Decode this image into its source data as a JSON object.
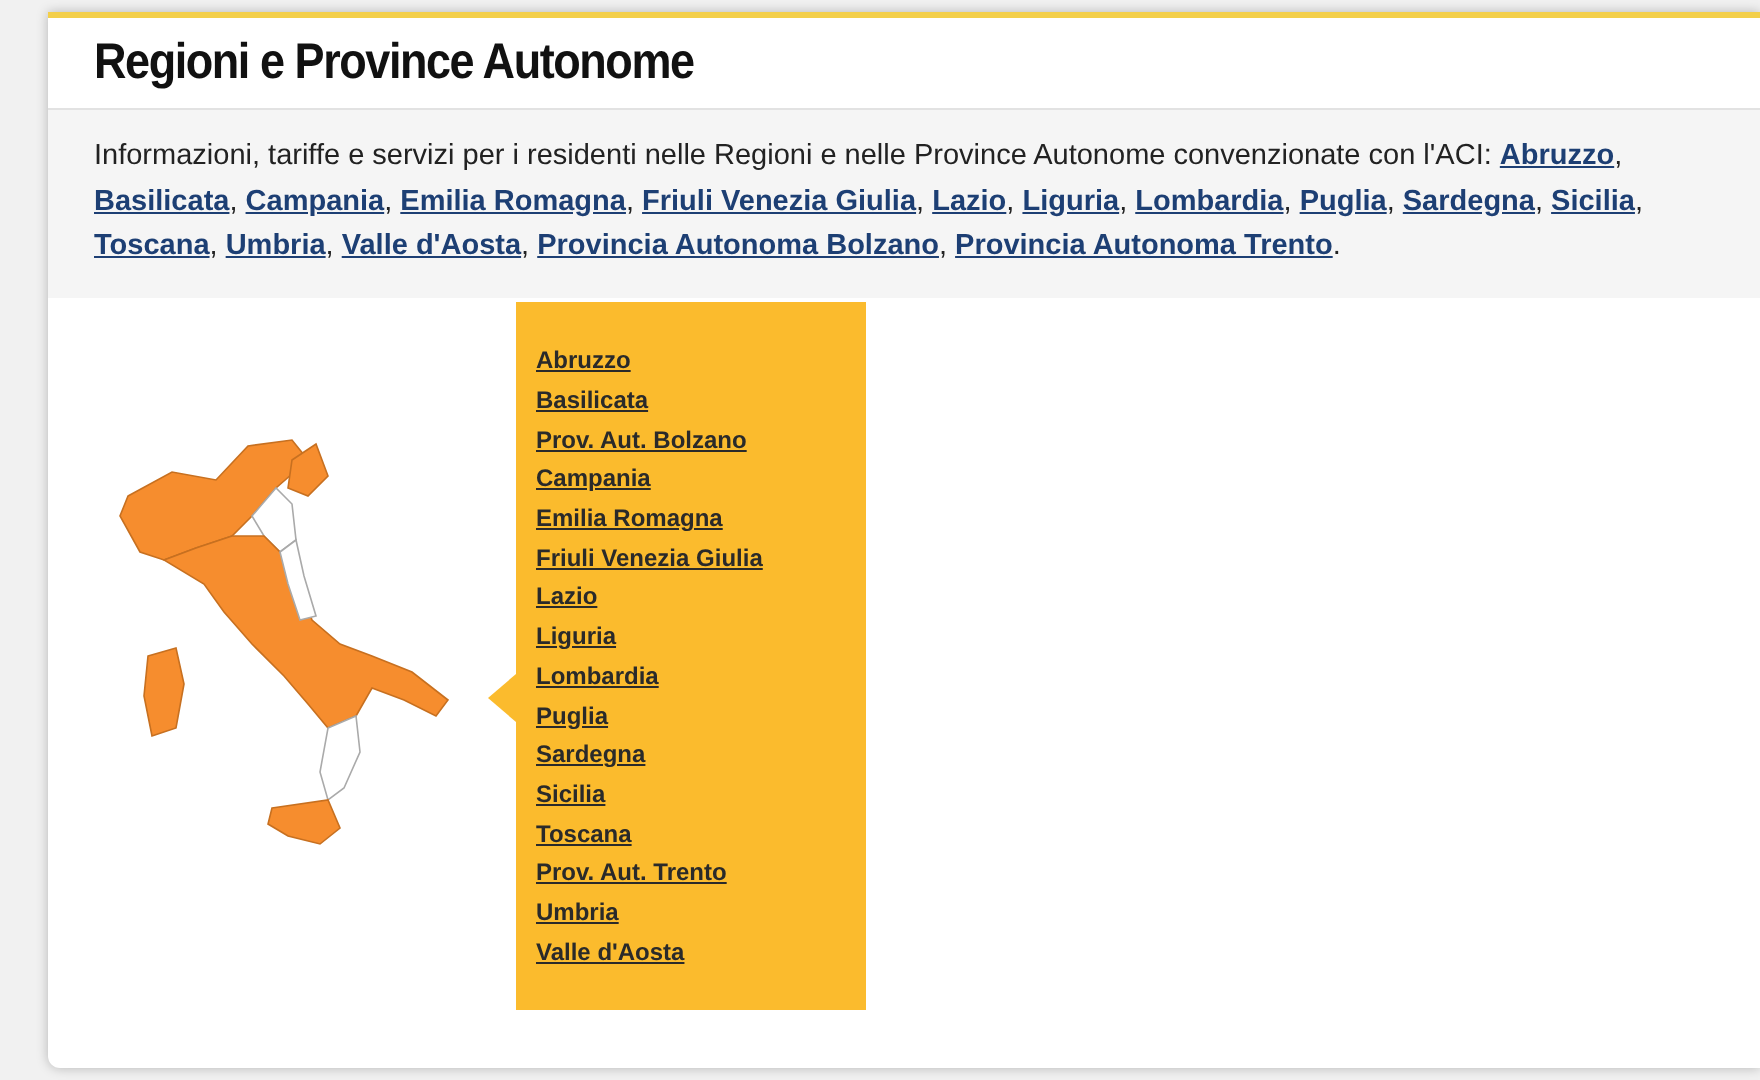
{
  "title": "Regioni e Province Autonome",
  "intro": {
    "lead": "Informazioni, tariffe e servizi per i residenti nelle Regioni e nelle Province Autonome convenzionate con l'ACI:",
    "separator": ",",
    "end": ".",
    "links": [
      "Abruzzo",
      "Basilicata",
      "Campania",
      "Emilia Romagna",
      "Friuli Venezia Giulia",
      "Lazio",
      "Liguria",
      "Lombardia",
      "Puglia",
      "Sardegna",
      "Sicilia",
      "Toscana",
      "Umbria",
      "Valle d'Aosta",
      "Provincia Autonoma Bolzano",
      "Provincia Autonoma Trento"
    ]
  },
  "region_menu": [
    "Abruzzo",
    "Basilicata",
    "Prov. Aut. Bolzano",
    "Campania",
    "Emilia Romagna",
    "Friuli Venezia Giulia",
    "Lazio",
    "Liguria",
    "Lombardia",
    "Puglia",
    "Sardegna",
    "Sicilia",
    "Toscana",
    "Prov. Aut. Trento",
    "Umbria",
    "Valle d'Aosta"
  ]
}
